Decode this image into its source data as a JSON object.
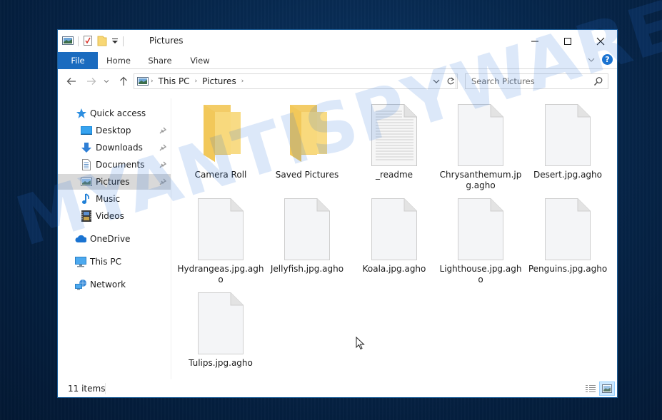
{
  "window": {
    "title": "Pictures",
    "controls": {
      "minimize": "minimize-icon",
      "maximize": "maximize-icon",
      "close": "close-icon"
    }
  },
  "ribbon": {
    "tabs": [
      {
        "label": "File",
        "active": true
      },
      {
        "label": "Home"
      },
      {
        "label": "Share"
      },
      {
        "label": "View"
      }
    ],
    "accent_color": "#1a6bbf"
  },
  "address": {
    "segments": [
      "This PC",
      "Pictures"
    ],
    "search_placeholder": "Search Pictures"
  },
  "navpane": {
    "quick_access": {
      "label": "Quick access",
      "icon": "star-icon"
    },
    "pinned": [
      {
        "label": "Desktop",
        "icon": "desktop-icon",
        "pinned": true
      },
      {
        "label": "Downloads",
        "icon": "download-icon",
        "pinned": true
      },
      {
        "label": "Documents",
        "icon": "documents-icon",
        "pinned": true
      },
      {
        "label": "Pictures",
        "icon": "pictures-icon",
        "pinned": true,
        "selected": true
      },
      {
        "label": "Music",
        "icon": "music-icon"
      },
      {
        "label": "Videos",
        "icon": "videos-icon"
      }
    ],
    "roots": [
      {
        "label": "OneDrive",
        "icon": "cloud-icon"
      },
      {
        "label": "This PC",
        "icon": "computer-icon"
      },
      {
        "label": "Network",
        "icon": "network-icon"
      }
    ]
  },
  "files": [
    {
      "name": "Camera Roll",
      "type": "folder"
    },
    {
      "name": "Saved Pictures",
      "type": "folder"
    },
    {
      "name": "_readme",
      "type": "text"
    },
    {
      "name": "Chrysanthemum.jpg.agho",
      "type": "blank"
    },
    {
      "name": "Desert.jpg.agho",
      "type": "blank"
    },
    {
      "name": "Hydrangeas.jpg.agho",
      "type": "blank"
    },
    {
      "name": "Jellyfish.jpg.agho",
      "type": "blank"
    },
    {
      "name": "Koala.jpg.agho",
      "type": "blank"
    },
    {
      "name": "Lighthouse.jpg.agho",
      "type": "blank"
    },
    {
      "name": "Penguins.jpg.agho",
      "type": "blank"
    },
    {
      "name": "Tulips.jpg.agho",
      "type": "blank"
    }
  ],
  "status": {
    "item_count": "11 items"
  },
  "watermark": "MYANTISPYWARE.COM"
}
